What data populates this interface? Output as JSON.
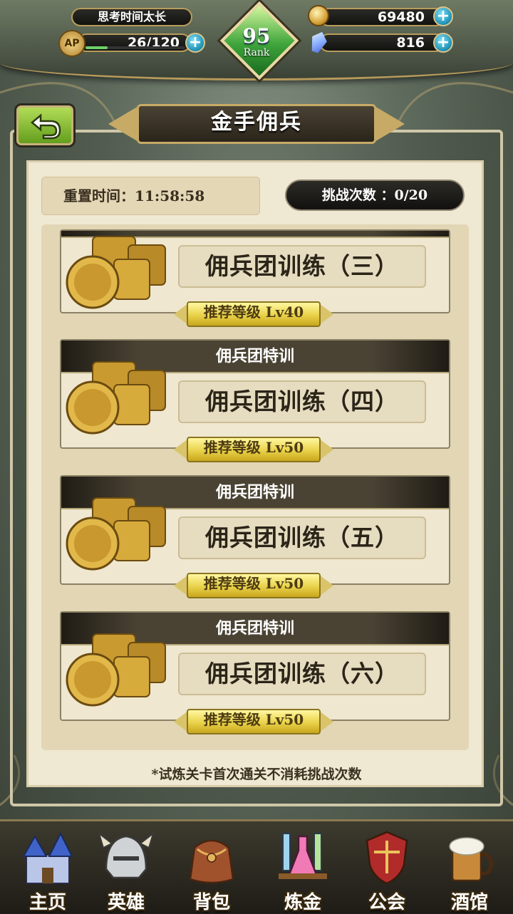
{
  "hud": {
    "status_text": "思考时间太长",
    "ap_label": "AP",
    "ap_value": "26/120",
    "ap_fill_fraction": 0.22,
    "rank_number": "95",
    "rank_label": "Rank",
    "gold_value": "69480",
    "gem_value": "816",
    "plus_symbol": "+"
  },
  "header": {
    "title": "金手佣兵",
    "back_icon": "back-arrow-icon"
  },
  "info": {
    "reset_label": "重置时间：11:58:58",
    "challenge_label": "挑战次数 ：0/20"
  },
  "cards": [
    {
      "header": "",
      "name": "佣兵团训练（三）",
      "level": "推荐等级 Lv40"
    },
    {
      "header": "佣兵团特训",
      "name": "佣兵团训练（四）",
      "level": "推荐等级 Lv50"
    },
    {
      "header": "佣兵团特训",
      "name": "佣兵团训练（五）",
      "level": "推荐等级 Lv50"
    },
    {
      "header": "佣兵团特训",
      "name": "佣兵团训练（六）",
      "level": "推荐等级 Lv50"
    }
  ],
  "footnote": "*试炼关卡首次通关不消耗挑战次数",
  "nav": [
    {
      "label": "主页",
      "icon": "castle-icon"
    },
    {
      "label": "英雄",
      "icon": "helmet-icon"
    },
    {
      "label": "背包",
      "icon": "bag-icon"
    },
    {
      "label": "炼金",
      "icon": "potion-icon"
    },
    {
      "label": "公会",
      "icon": "guild-shield-icon"
    },
    {
      "label": "酒馆",
      "icon": "beer-mug-icon"
    }
  ],
  "colors": {
    "accent_gold": "#c7aa66",
    "panel_bg": "#efe8d2",
    "level_badge": "#e9d24a",
    "back_green": "#8cc63a"
  }
}
